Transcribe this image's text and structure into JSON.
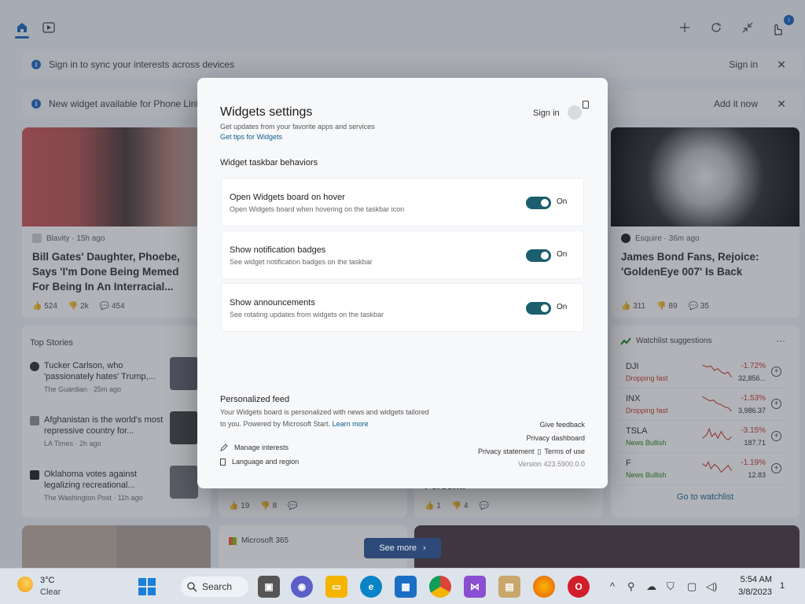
{
  "header": {
    "icons": [
      "home-icon",
      "video-icon",
      "plus-icon",
      "refresh-icon",
      "minimize-icon",
      "profile-icon"
    ],
    "badge": "i"
  },
  "notices": [
    {
      "text": "Sign in to sync your interests across devices",
      "action": "Sign in"
    },
    {
      "text": "New widget available for Phone Link.",
      "action": "Add it now"
    }
  ],
  "news_left": {
    "source": "Blavity · 15h ago",
    "headline": "Bill Gates' Daughter, Phoebe, Says 'I'm Done Being Memed For Being In An Interracial...",
    "reacts": [
      "524",
      "2k",
      "454"
    ]
  },
  "news_right": {
    "source": "Esquire · 36m ago",
    "headline": "James Bond Fans, Rejoice: 'GoldenEye 007' Is Back",
    "reacts": [
      "311",
      "89",
      "35"
    ]
  },
  "top_stories": {
    "title": "Top Stories",
    "items": [
      {
        "title": "Tucker Carlson, who 'passionately hates' Trump,...",
        "source": "The Guardian · 25m ago"
      },
      {
        "title": "Afghanistan is the world's most repressive country for...",
        "source": "LA Times · 2h ago"
      },
      {
        "title": "Oklahoma votes against legalizing recreational...",
        "source": "The Washington Post · 11h ago"
      }
    ]
  },
  "middle_reacts": [
    "19",
    "8"
  ],
  "third_col": {
    "partial": "Persona",
    "reacts": [
      "1",
      "4"
    ]
  },
  "watchlist": {
    "title": "Watchlist suggestions",
    "more": "···",
    "stocks": [
      {
        "sym": "DJI",
        "status": "Dropping fast",
        "pct": "-1.72%",
        "val": "32,856...",
        "color": "#c42b1c"
      },
      {
        "sym": "INX",
        "status": "Dropping fast",
        "pct": "-1.53%",
        "val": "3,986.37",
        "color": "#c42b1c"
      },
      {
        "sym": "TSLA",
        "status": "News Bullish",
        "pct": "-3.15%",
        "val": "187.71",
        "color": "#107c10"
      },
      {
        "sym": "F",
        "status": "News Bullish",
        "pct": "-1.19%",
        "val": "12.83",
        "color": "#107c10"
      }
    ],
    "goto": "Go to watchlist"
  },
  "bottom": {
    "ms365": "Microsoft 365",
    "see_more": "See more"
  },
  "dialog": {
    "title": "Widgets settings",
    "subtitle": "Get updates from your favorite apps and services",
    "tips": "Get tips for Widgets",
    "sign_in": "Sign in",
    "section": "Widget taskbar behaviors",
    "settings": [
      {
        "title": "Open Widgets board on hover",
        "desc": "Open Widgets board when hovering on the taskbar icon",
        "state": "On"
      },
      {
        "title": "Show notification badges",
        "desc": "See widget notification badges on the taskbar",
        "state": "On"
      },
      {
        "title": "Show announcements",
        "desc": "See rotating updates from widgets on the taskbar",
        "state": "On"
      }
    ],
    "feed_title": "Personalized feed",
    "feed_desc1": "Your Widgets board is personalized with news and widgets tailored",
    "feed_desc2": "to you. Powered by Microsoft Start.",
    "learn_more": "Learn more",
    "manage": "Manage interests",
    "language": "Language and region",
    "give_feedback": "Give feedback",
    "privacy_dashboard": "Privacy dashboard",
    "privacy_statement": "Privacy statement",
    "terms": "Terms of use",
    "version": "Version 423.5900.0.0"
  },
  "taskbar": {
    "weather_temp": "3°C",
    "weather_desc": "Clear",
    "search": "Search",
    "time": "5:54 AM",
    "date": "3/8/2023",
    "notif": "1",
    "accent": "#0a5eb8"
  }
}
